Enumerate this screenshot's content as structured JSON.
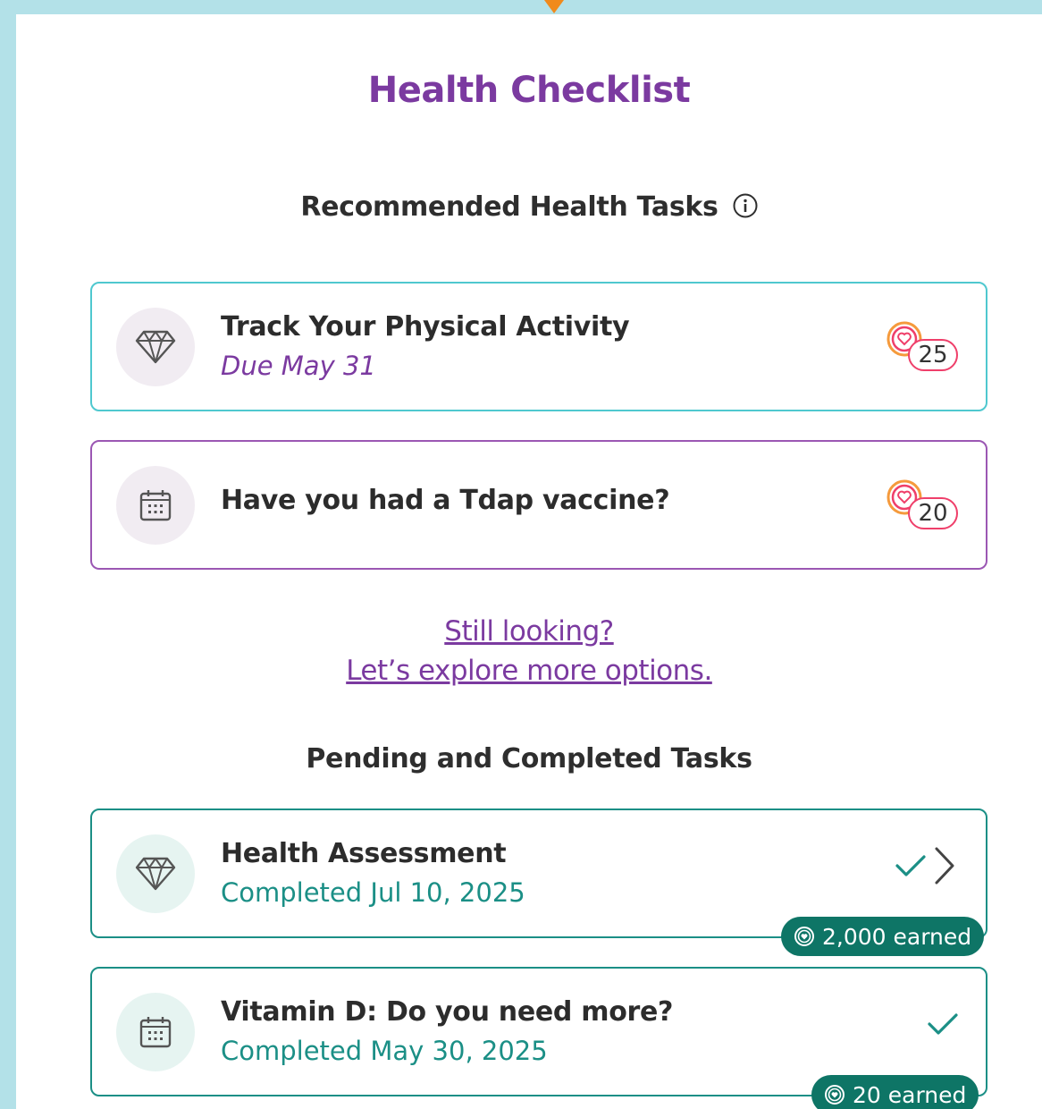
{
  "page": {
    "title": "Health Checklist"
  },
  "recommended": {
    "heading": "Recommended Health Tasks",
    "tasks": [
      {
        "title": "Track Your Physical Activity",
        "due": "Due May 31",
        "points": "25",
        "icon": "diamond-icon"
      },
      {
        "title": "Have you had a Tdap vaccine?",
        "points": "20",
        "icon": "calendar-icon"
      }
    ]
  },
  "explore": {
    "line1": "Still looking?",
    "line2": "Let’s explore more options."
  },
  "pending": {
    "heading": "Pending and Completed Tasks",
    "tasks": [
      {
        "title": "Health Assessment",
        "status": "Completed Jul 10, 2025",
        "earned": "2,000 earned",
        "icon": "diamond-icon"
      },
      {
        "title": "Vitamin D: Do you need more?",
        "status": "Completed May 30, 2025",
        "earned": "20 earned",
        "icon": "calendar-icon"
      }
    ]
  },
  "colors": {
    "background": "#b3e1e8",
    "brand_purple": "#7b3aa0",
    "teal": "#1b8f86",
    "earned_badge": "#0e7566",
    "points_ring": "#ef3f6a",
    "arrow": "#f08a1c"
  }
}
